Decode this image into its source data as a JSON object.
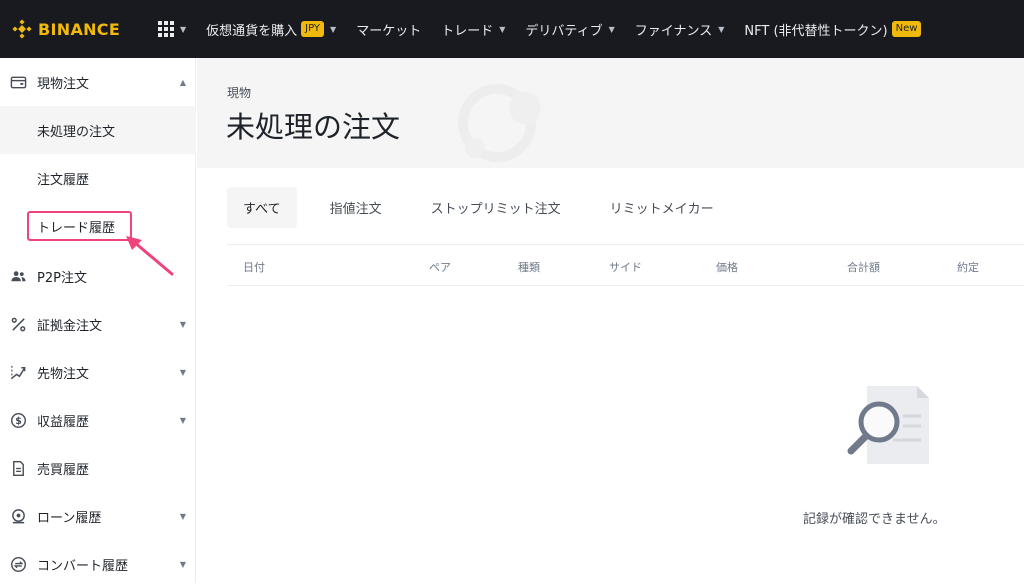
{
  "app": {
    "logo_text": "BINANCE",
    "brand_color": "#f0b90b"
  },
  "topnav": {
    "items": [
      {
        "label": "仮想通貨を購入",
        "badge": "JPY",
        "caret": true
      },
      {
        "label": "マーケット",
        "caret": false
      },
      {
        "label": "トレード",
        "caret": true
      },
      {
        "label": "デリバティブ",
        "caret": true
      },
      {
        "label": "ファイナンス",
        "caret": true
      },
      {
        "label": "NFT (非代替性トークン)",
        "badge": "New",
        "caret": false
      }
    ]
  },
  "sidebar": {
    "spot": {
      "label": "現物注文",
      "icon": "wallet-icon"
    },
    "spot_sub": [
      "未処理の注文",
      "注文履歴",
      "トレード履歴"
    ],
    "items": [
      {
        "label": "P2P注文",
        "icon": "users-icon",
        "chevron": false
      },
      {
        "label": "証拠金注文",
        "icon": "percent-icon",
        "chevron": true
      },
      {
        "label": "先物注文",
        "icon": "futures-icon",
        "chevron": true
      },
      {
        "label": "収益履歴",
        "icon": "dollar-icon",
        "chevron": true
      },
      {
        "label": "売買履歴",
        "icon": "document-icon",
        "chevron": false
      },
      {
        "label": "ローン履歴",
        "icon": "loan-icon",
        "chevron": true
      },
      {
        "label": "コンバート履歴",
        "icon": "convert-icon",
        "chevron": true
      }
    ]
  },
  "header": {
    "breadcrumb": "現物",
    "title": "未処理の注文"
  },
  "tabs": [
    "すべて",
    "指値注文",
    "ストップリミット注文",
    "リミットメイカー"
  ],
  "table": {
    "columns": [
      "日付",
      "ペア",
      "種類",
      "サイド",
      "価格",
      "合計額",
      "約定"
    ]
  },
  "empty": {
    "message": "記録が確認できません。",
    "icon": "magnifier-document-icon"
  },
  "colors": {
    "accent": "#f0b90b",
    "highlight": "#f0437c"
  }
}
